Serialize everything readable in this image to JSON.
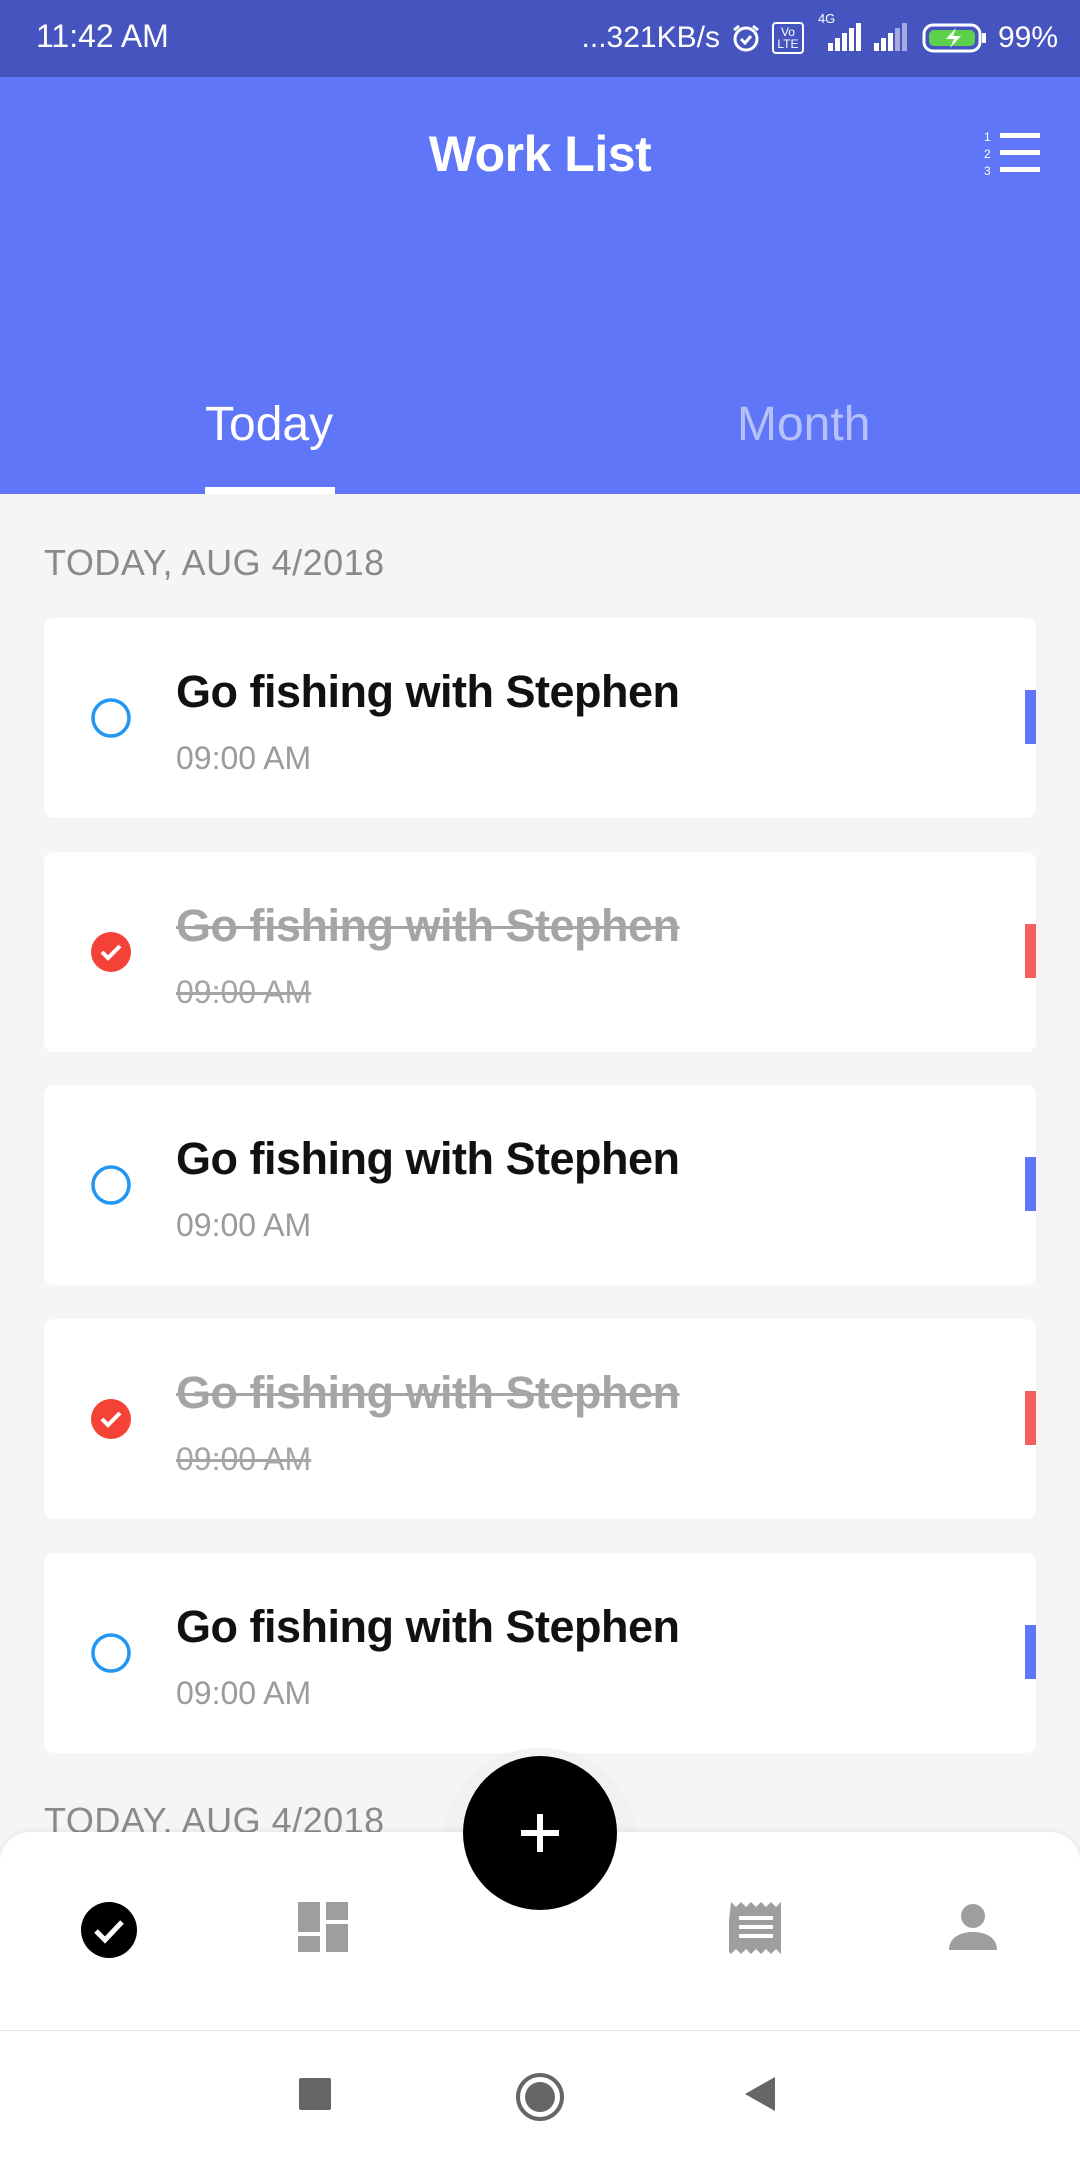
{
  "status_bar": {
    "time": "11:42 AM",
    "network_speed": "...321KB/s",
    "volte": "Vo LTE",
    "network_type": "4G",
    "battery": "99%",
    "icons": [
      "alarm-icon",
      "volte-icon",
      "signal-icon",
      "signal-icon",
      "battery-charging-icon"
    ]
  },
  "header": {
    "title": "Work List",
    "sort_icon": "sort-numbered-list-icon",
    "tabs": [
      {
        "label": "Today",
        "active": true
      },
      {
        "label": "Month",
        "active": false
      }
    ]
  },
  "sections": [
    {
      "date": "TODAY, AUG 4/2018",
      "tasks": [
        {
          "title": "Go fishing with Stephen",
          "time": "09:00 AM",
          "done": false
        },
        {
          "title": "Go fishing with Stephen",
          "time": "09:00 AM",
          "done": true
        },
        {
          "title": "Go fishing with Stephen",
          "time": "09:00 AM",
          "done": false
        },
        {
          "title": "Go fishing with Stephen",
          "time": "09:00 AM",
          "done": true
        },
        {
          "title": "Go fishing with Stephen",
          "time": "09:00 AM",
          "done": false
        }
      ]
    },
    {
      "date": "TODAY, AUG 4/2018",
      "tasks": []
    }
  ],
  "bottom_nav": {
    "items": [
      "check-circle-icon",
      "dashboard-icon",
      "add-icon",
      "receipt-icon",
      "person-icon"
    ],
    "active": "check-circle-icon"
  },
  "system_nav": [
    "recent-apps-icon",
    "home-icon",
    "back-icon"
  ],
  "colors": {
    "status_bar": "#4654c0",
    "header": "#5e76f7",
    "open_check": "#2196f3",
    "done_check": "#f44336",
    "open_priority": "#5e76f7",
    "done_priority": "#f76060",
    "fab": "#000000"
  }
}
